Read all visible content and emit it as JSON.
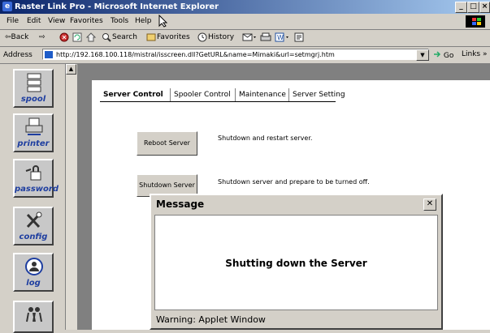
{
  "window": {
    "title": "Raster Link Pro - Microsoft Internet Explorer"
  },
  "menu": [
    "File",
    "Edit",
    "View",
    "Favorites",
    "Tools",
    "Help"
  ],
  "toolbar": {
    "back": "⇦Back",
    "forward": "⇨",
    "search": "Search",
    "favorites": "Favorites",
    "history": "History"
  },
  "address": {
    "label": "Address",
    "url": "http://192.168.100.118/mistral/isscreen.dll?GetURL&name=Mimaki&url=setmgrj.htm",
    "go": "Go",
    "links": "Links"
  },
  "sidebar": {
    "items": [
      {
        "label": "spool",
        "icon": "spool-icon"
      },
      {
        "label": "printer",
        "icon": "printer-icon"
      },
      {
        "label": "password",
        "icon": "password-icon"
      },
      {
        "label": "config",
        "icon": "config-icon"
      },
      {
        "label": "log",
        "icon": "log-icon"
      },
      {
        "label": "",
        "icon": "users-icon"
      }
    ]
  },
  "tabs": [
    "Server Control",
    "Spooler Control",
    "Maintenance",
    "Server Setting"
  ],
  "actions": [
    {
      "button": "Reboot Server",
      "description": "Shutdown and restart server."
    },
    {
      "button": "Shutdown Server",
      "description": "Shutdown server and prepare to be turned off."
    }
  ],
  "dialog": {
    "title": "Message",
    "close": "✕",
    "message": "Shutting down the Server",
    "warning": "Warning: Applet Window"
  }
}
